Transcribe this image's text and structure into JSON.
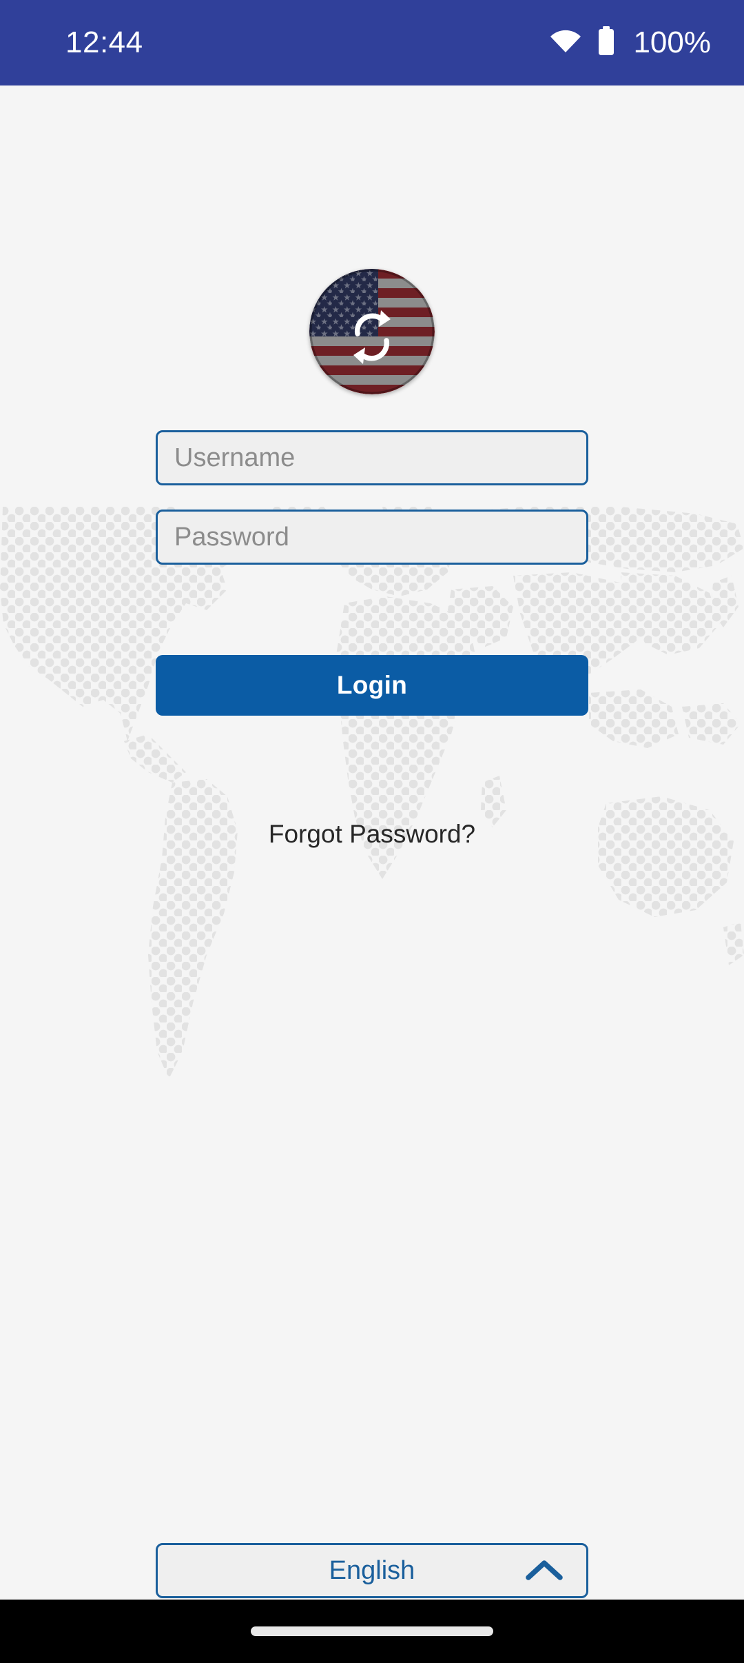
{
  "status_bar": {
    "time": "12:44",
    "battery_percent": "100%",
    "wifi_icon": "wifi-icon",
    "battery_icon": "battery-full-icon",
    "background_color": "#30409a",
    "text_color": "#ffffff"
  },
  "branding": {
    "logo_icon": "us-flag-exchange-logo",
    "logo_description": "Circular United States flag with two white curved exchange arrows",
    "flag_canton_color": "#232947",
    "flag_star_color": "#6d7183",
    "flag_stripe_red": "#6e1f24",
    "flag_stripe_light": "#8c8c8c",
    "arrow_color": "#ffffff"
  },
  "form": {
    "username": {
      "value": "",
      "placeholder": "Username"
    },
    "password": {
      "value": "",
      "placeholder": "Password"
    },
    "login_label": "Login",
    "forgot_password_label": "Forgot Password?",
    "field_border_color": "#1a5f9c",
    "field_fill_color": "#efefef",
    "placeholder_color": "#8c8c8c",
    "button_color": "#0b5ca5",
    "button_text_color": "#ffffff",
    "forgot_password_color": "#272727"
  },
  "language_selector": {
    "selected": "English",
    "chevron_icon": "chevron-up-icon",
    "expanded": false,
    "text_color": "#1a5f9c",
    "border_color": "#1a5f9c"
  },
  "background": {
    "page_color": "#f5f5f5",
    "map_dot_color": "#e2e2e2",
    "map_description": "Dotted world map watermark"
  },
  "nav_bar": {
    "handle_icon": "gesture-handle",
    "background_color": "#000000",
    "handle_color": "#e8e8e8"
  }
}
